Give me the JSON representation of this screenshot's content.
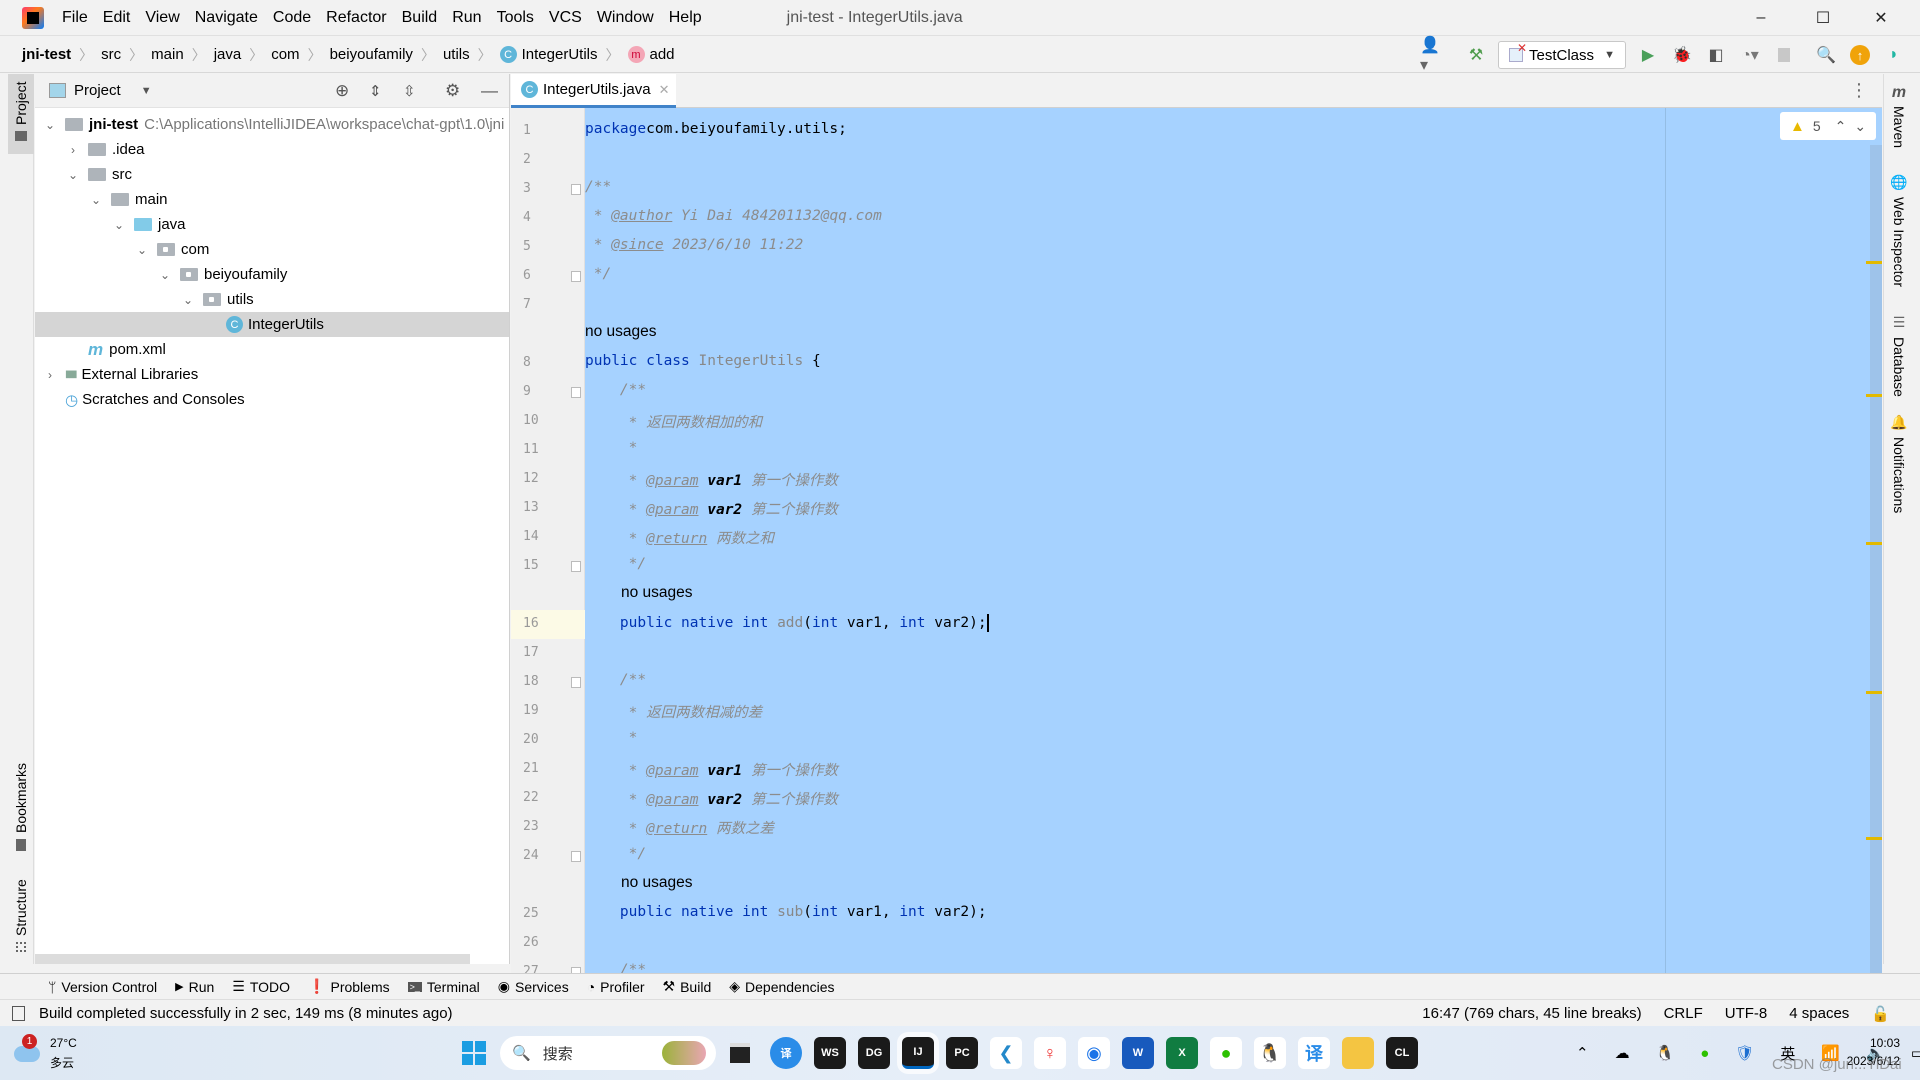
{
  "titlebar": {
    "menu": [
      "File",
      "Edit",
      "View",
      "Navigate",
      "Code",
      "Refactor",
      "Build",
      "Run",
      "Tools",
      "VCS",
      "Window",
      "Help"
    ],
    "title": "jni-test - IntegerUtils.java",
    "minimize": "–",
    "maximize": "☐",
    "close": "✕"
  },
  "breadcrumb": [
    {
      "label": "jni-test",
      "bold": true
    },
    {
      "label": "src"
    },
    {
      "label": "main"
    },
    {
      "label": "java"
    },
    {
      "label": "com"
    },
    {
      "label": "beiyoufamily"
    },
    {
      "label": "utils"
    },
    {
      "label": "IntegerUtils",
      "icon": "class-icon"
    },
    {
      "label": "add",
      "icon": "method-icon"
    }
  ],
  "toolbar": {
    "run_config": "TestClass",
    "icons": [
      "vcs-user-icon",
      "build-hammer-icon",
      "run-icon",
      "debug-icon",
      "coverage-icon",
      "profiler-icon",
      "stop-icon",
      "search-icon",
      "update-icon",
      "code-with-me-icon"
    ]
  },
  "left_stripe": {
    "project": "Project",
    "bookmarks": "Bookmarks",
    "structure": "Structure"
  },
  "project": {
    "header": "Project",
    "tree": [
      {
        "label": "jni-test",
        "path": "C:\\Applications\\IntelliJIDEA\\workspace\\chat-gpt\\1.0\\jni",
        "level": 0,
        "expanded": true,
        "icon": "module-icon",
        "bold": true
      },
      {
        "label": ".idea",
        "level": 1,
        "expanded": false,
        "icon": "folder-icon"
      },
      {
        "label": "src",
        "level": 1,
        "expanded": true,
        "icon": "folder-icon"
      },
      {
        "label": "main",
        "level": 2,
        "expanded": true,
        "icon": "folder-icon"
      },
      {
        "label": "java",
        "level": 3,
        "expanded": true,
        "icon": "source-folder-icon"
      },
      {
        "label": "com",
        "level": 4,
        "expanded": true,
        "icon": "package-icon"
      },
      {
        "label": "beiyoufamily",
        "level": 5,
        "expanded": true,
        "icon": "package-icon"
      },
      {
        "label": "utils",
        "level": 6,
        "expanded": true,
        "icon": "package-icon"
      },
      {
        "label": "IntegerUtils",
        "level": 7,
        "icon": "class-icon",
        "selected": true
      },
      {
        "label": "pom.xml",
        "level": 1,
        "icon": "maven-icon"
      },
      {
        "label": "External Libraries",
        "level": 0,
        "expanded": false,
        "icon": "libraries-icon"
      },
      {
        "label": "Scratches and Consoles",
        "level": 0,
        "icon": "scratches-icon"
      }
    ]
  },
  "editor": {
    "tab": "IntegerUtils.java",
    "warnings": "5",
    "lines": [
      {
        "n": "1",
        "parts": [
          [
            "kw",
            "package"
          ],
          [
            "",
            "com.beiyoufamily.utils;"
          ]
        ]
      },
      {
        "n": "2",
        "parts": []
      },
      {
        "n": "3",
        "parts": [
          [
            "cm",
            "/**"
          ]
        ]
      },
      {
        "n": "4",
        "parts": [
          [
            "cm",
            " * "
          ],
          [
            "tag",
            "@author"
          ],
          [
            "cm",
            " Yi Dai 484201132@qq.com"
          ]
        ]
      },
      {
        "n": "5",
        "parts": [
          [
            "cm",
            " * "
          ],
          [
            "tag",
            "@since"
          ],
          [
            "cm",
            " 2023/6/10 11:22"
          ]
        ]
      },
      {
        "n": "6",
        "parts": [
          [
            "cm",
            " */"
          ]
        ]
      },
      {
        "n": "7",
        "parts": []
      },
      {
        "hint": "no usages"
      },
      {
        "n": "8",
        "parts": [
          [
            "kw",
            "public class "
          ],
          [
            "mn",
            "IntegerUtils"
          ],
          [
            "",
            " {"
          ]
        ]
      },
      {
        "n": "9",
        "parts": [
          [
            "cm",
            "    /**"
          ]
        ]
      },
      {
        "n": "10",
        "parts": [
          [
            "cm",
            "     * 返回两数相加的和"
          ]
        ]
      },
      {
        "n": "11",
        "parts": [
          [
            "cm",
            "     *"
          ]
        ]
      },
      {
        "n": "12",
        "parts": [
          [
            "cm",
            "     * "
          ],
          [
            "tag",
            "@param"
          ],
          [
            "pv",
            " var1"
          ],
          [
            "cm",
            " 第一个操作数"
          ]
        ]
      },
      {
        "n": "13",
        "parts": [
          [
            "cm",
            "     * "
          ],
          [
            "tag",
            "@param"
          ],
          [
            "pv",
            " var2"
          ],
          [
            "cm",
            " 第二个操作数"
          ]
        ]
      },
      {
        "n": "14",
        "parts": [
          [
            "cm",
            "     * "
          ],
          [
            "tag",
            "@return"
          ],
          [
            "cm",
            " 两数之和"
          ]
        ]
      },
      {
        "n": "15",
        "parts": [
          [
            "cm",
            "     */"
          ]
        ]
      },
      {
        "hint": "no usages",
        "indent": true
      },
      {
        "n": "16",
        "parts": [
          [
            "kw",
            "    public native int "
          ],
          [
            "mn",
            "add"
          ],
          [
            "",
            "("
          ],
          [
            "kw",
            "int"
          ],
          [
            "",
            " var1, "
          ],
          [
            "kw",
            "int"
          ],
          [
            "",
            " var2);"
          ]
        ],
        "caret": true
      },
      {
        "n": "17",
        "parts": []
      },
      {
        "n": "18",
        "parts": [
          [
            "cm",
            "    /**"
          ]
        ]
      },
      {
        "n": "19",
        "parts": [
          [
            "cm",
            "     * 返回两数相减的差"
          ]
        ]
      },
      {
        "n": "20",
        "parts": [
          [
            "cm",
            "     *"
          ]
        ]
      },
      {
        "n": "21",
        "parts": [
          [
            "cm",
            "     * "
          ],
          [
            "tag",
            "@param"
          ],
          [
            "pv",
            " var1"
          ],
          [
            "cm",
            " 第一个操作数"
          ]
        ]
      },
      {
        "n": "22",
        "parts": [
          [
            "cm",
            "     * "
          ],
          [
            "tag",
            "@param"
          ],
          [
            "pv",
            " var2"
          ],
          [
            "cm",
            " 第二个操作数"
          ]
        ]
      },
      {
        "n": "23",
        "parts": [
          [
            "cm",
            "     * "
          ],
          [
            "tag",
            "@return"
          ],
          [
            "cm",
            " 两数之差"
          ]
        ]
      },
      {
        "n": "24",
        "parts": [
          [
            "cm",
            "     */"
          ]
        ]
      },
      {
        "hint": "no usages",
        "indent": true
      },
      {
        "n": "25",
        "parts": [
          [
            "kw",
            "    public native int "
          ],
          [
            "mn",
            "sub"
          ],
          [
            "",
            "("
          ],
          [
            "kw",
            "int"
          ],
          [
            "",
            " var1, "
          ],
          [
            "kw",
            "int"
          ],
          [
            "",
            " var2);"
          ]
        ]
      },
      {
        "n": "26",
        "parts": []
      },
      {
        "n": "27",
        "parts": [
          [
            "cm",
            "    /**"
          ]
        ]
      }
    ]
  },
  "right_stripe": [
    "Maven",
    "Web Inspector",
    "Database",
    "Notifications"
  ],
  "bottom_tools": [
    "Version Control",
    "Run",
    "TODO",
    "Problems",
    "Terminal",
    "Services",
    "Profiler",
    "Build",
    "Dependencies"
  ],
  "status": {
    "message": "Build completed successfully in 2 sec, 149 ms (8 minutes ago)",
    "position": "16:47 (769 chars, 45 line breaks)",
    "line_sep": "CRLF",
    "encoding": "UTF-8",
    "indent": "4 spaces"
  },
  "taskbar": {
    "weather_temp": "27°C",
    "weather_desc": "多云",
    "weather_badge": "1",
    "search_placeholder": "搜索",
    "apps": [
      "WS",
      "DG",
      "IJ",
      "PC",
      "VS",
      "DB",
      "CH",
      "W",
      "X",
      "WX",
      "QQ",
      "FY",
      "FE",
      "CL"
    ],
    "ime": "英",
    "time": "10:03",
    "date": "2023/6/12",
    "watermark": "CSDN @jun...YiDai"
  }
}
